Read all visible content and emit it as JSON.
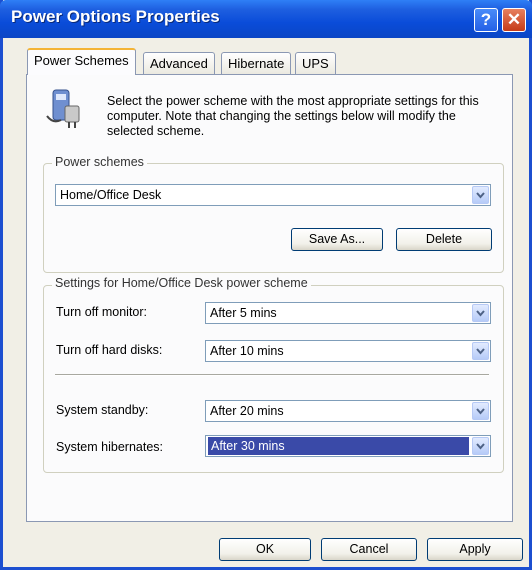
{
  "window": {
    "title": "Power Options Properties",
    "help_glyph": "?",
    "close_glyph": "✕"
  },
  "tabs": [
    {
      "label": "Power Schemes",
      "active": true
    },
    {
      "label": "Advanced",
      "active": false
    },
    {
      "label": "Hibernate",
      "active": false
    },
    {
      "label": "UPS",
      "active": false
    }
  ],
  "intro": {
    "icon": "power-plug-icon",
    "text": "Select the power scheme with the most appropriate settings for this computer. Note that changing the settings below will modify the selected scheme."
  },
  "schemes": {
    "legend": "Power schemes",
    "selected": "Home/Office Desk",
    "save_as_label": "Save As...",
    "delete_label": "Delete"
  },
  "settings": {
    "legend": "Settings for Home/Office Desk power scheme",
    "rows": [
      {
        "label": "Turn off monitor:",
        "value": "After 5 mins"
      },
      {
        "label": "Turn off hard disks:",
        "value": "After 10 mins"
      },
      {
        "label": "System standby:",
        "value": "After 20 mins"
      },
      {
        "label": "System hibernates:",
        "value": "After 30 mins"
      }
    ]
  },
  "footer": {
    "ok_label": "OK",
    "cancel_label": "Cancel",
    "apply_label": "Apply"
  },
  "colors": {
    "titlebar": "#0a4cd9",
    "accent_tab": "#f4b436",
    "selection": "#3a4aa8"
  }
}
